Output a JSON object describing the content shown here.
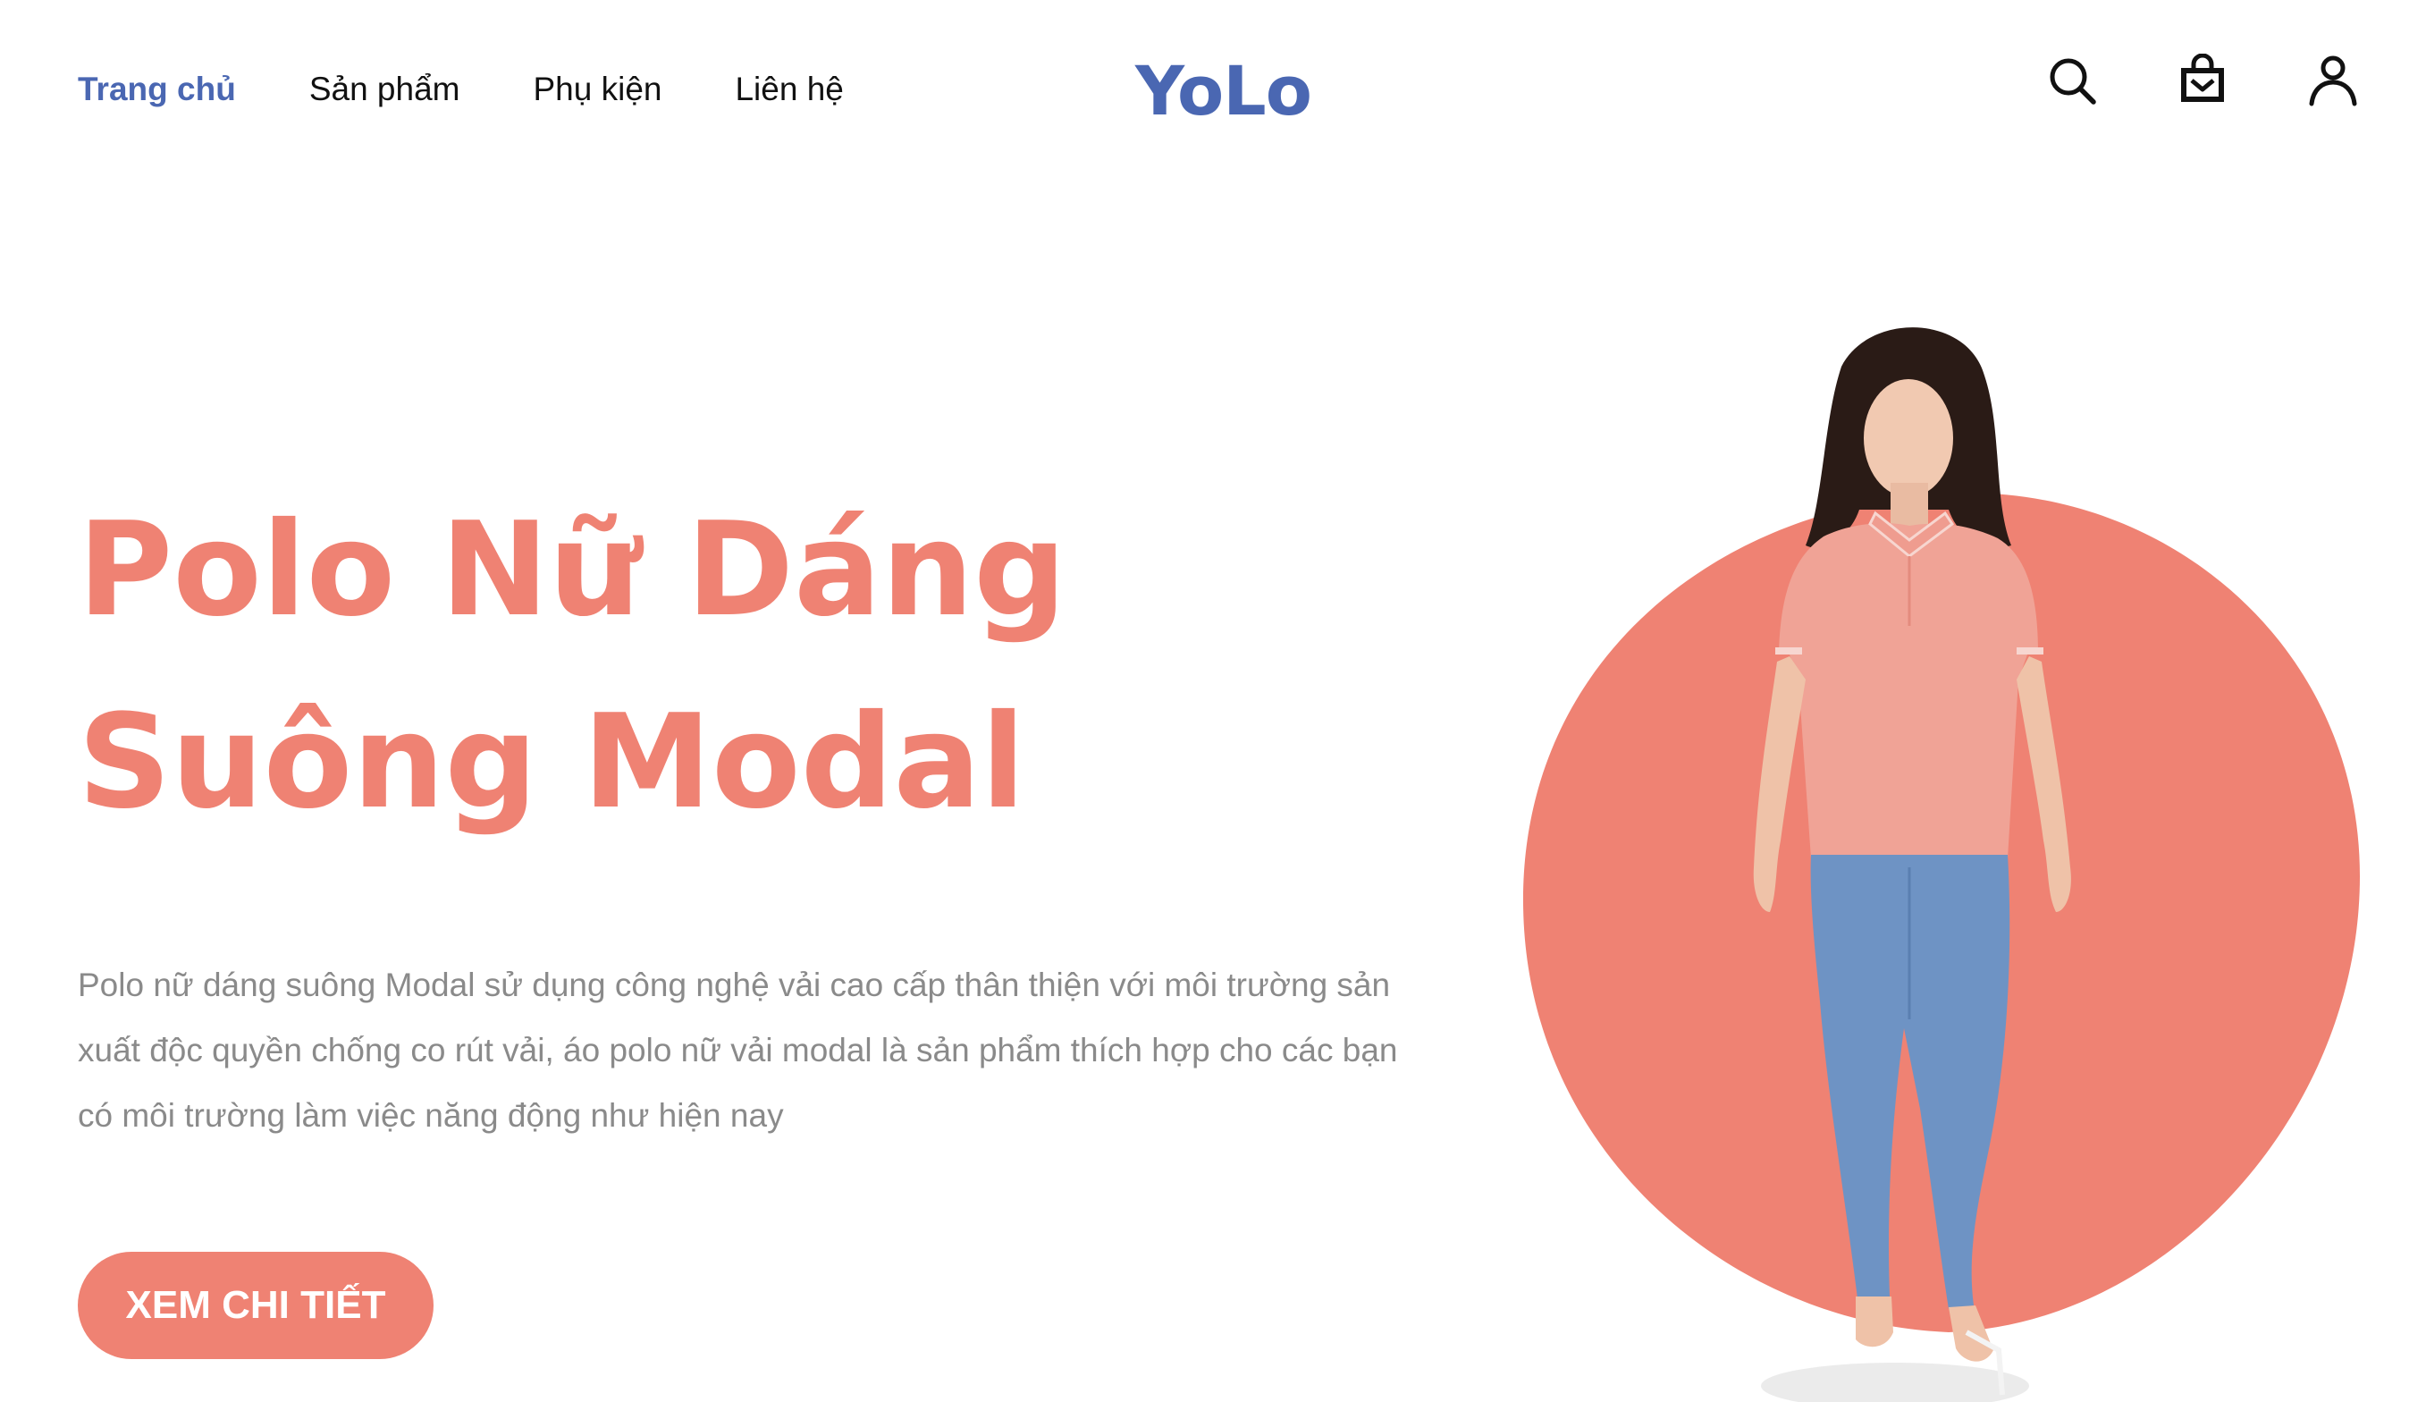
{
  "header": {
    "nav": [
      {
        "label": "Trang chủ",
        "active": true
      },
      {
        "label": "Sản phẩm",
        "active": false
      },
      {
        "label": "Phụ kiện",
        "active": false
      },
      {
        "label": "Liên hệ",
        "active": false
      }
    ],
    "logo": "YoLo",
    "icons": [
      "search-icon",
      "shopping-bag-icon",
      "user-icon"
    ]
  },
  "hero": {
    "title": "Polo Nữ Dáng Suông Modal",
    "description": "Polo nữ dáng suông Modal sử dụng công nghệ vải cao cấp thân thiện với môi trường sản xuất độc quyền chống co rút vải, áo polo nữ vải modal là sản phẩm thích hợp cho các bạn có môi trường làm việc năng động như hiện nay",
    "cta_label": "XEM CHI TIẾT"
  },
  "colors": {
    "brand": "#4a67b2",
    "accent": "#ef8273",
    "text_muted": "#8a8a8a"
  }
}
